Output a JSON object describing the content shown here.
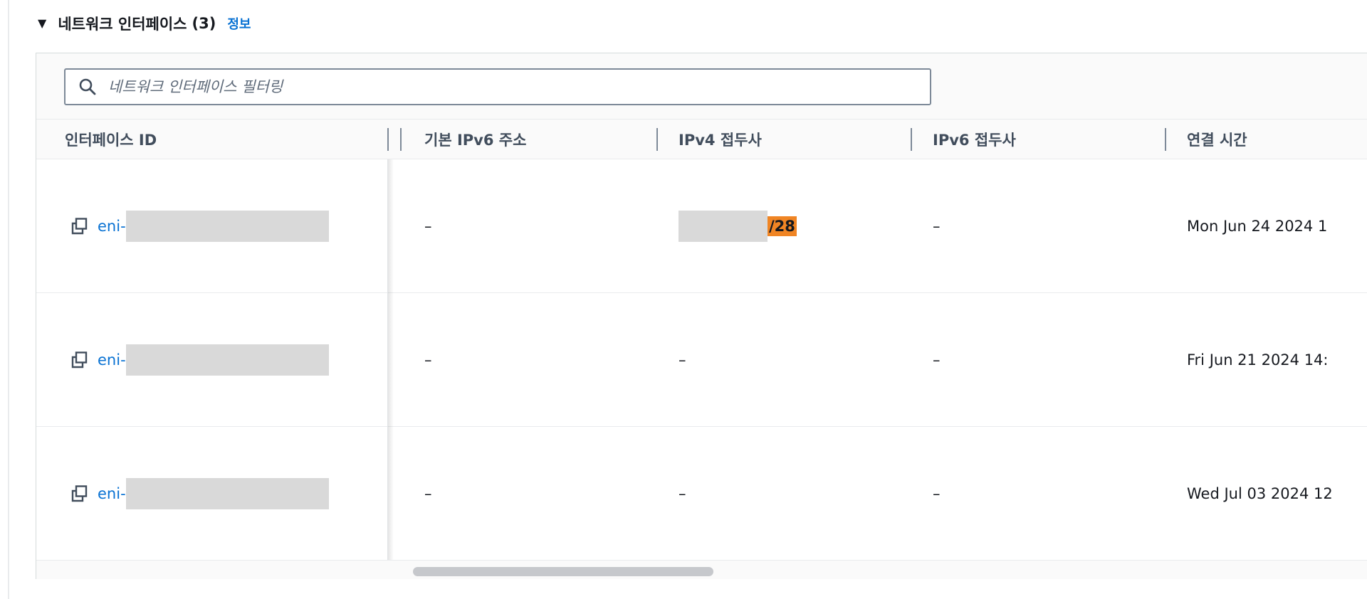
{
  "section": {
    "title": "네트워크 인터페이스",
    "count": "(3)",
    "info_label": "정보"
  },
  "search": {
    "placeholder": "네트워크 인터페이스 필터링",
    "value": ""
  },
  "table": {
    "columns": [
      "인터페이스 ID",
      "기본 IPv6 주소",
      "IPv4 접두사",
      "IPv6 접두사",
      "연결 시간"
    ],
    "rows": [
      {
        "interface_id": "eni-",
        "ipv6_address": "–",
        "ipv4_prefix": "",
        "ipv4_suffix": "/28",
        "ipv6_prefix": "–",
        "attach_time": "Mon Jun 24 2024 1"
      },
      {
        "interface_id": "eni-",
        "ipv6_address": "–",
        "ipv4_prefix": "–",
        "ipv4_suffix": "",
        "ipv6_prefix": "–",
        "attach_time": "Fri Jun 21 2024 14:"
      },
      {
        "interface_id": "eni-",
        "ipv6_address": "–",
        "ipv4_prefix": "–",
        "ipv4_suffix": "",
        "ipv6_prefix": "–",
        "attach_time": "Wed Jul 03 2024 12"
      }
    ]
  },
  "colors": {
    "link": "#0972d3",
    "highlight": "#f08524",
    "redaction": "#d9d9d9"
  },
  "icons": {
    "caret": "caret-down-icon",
    "search": "search-icon",
    "copy": "copy-icon"
  }
}
